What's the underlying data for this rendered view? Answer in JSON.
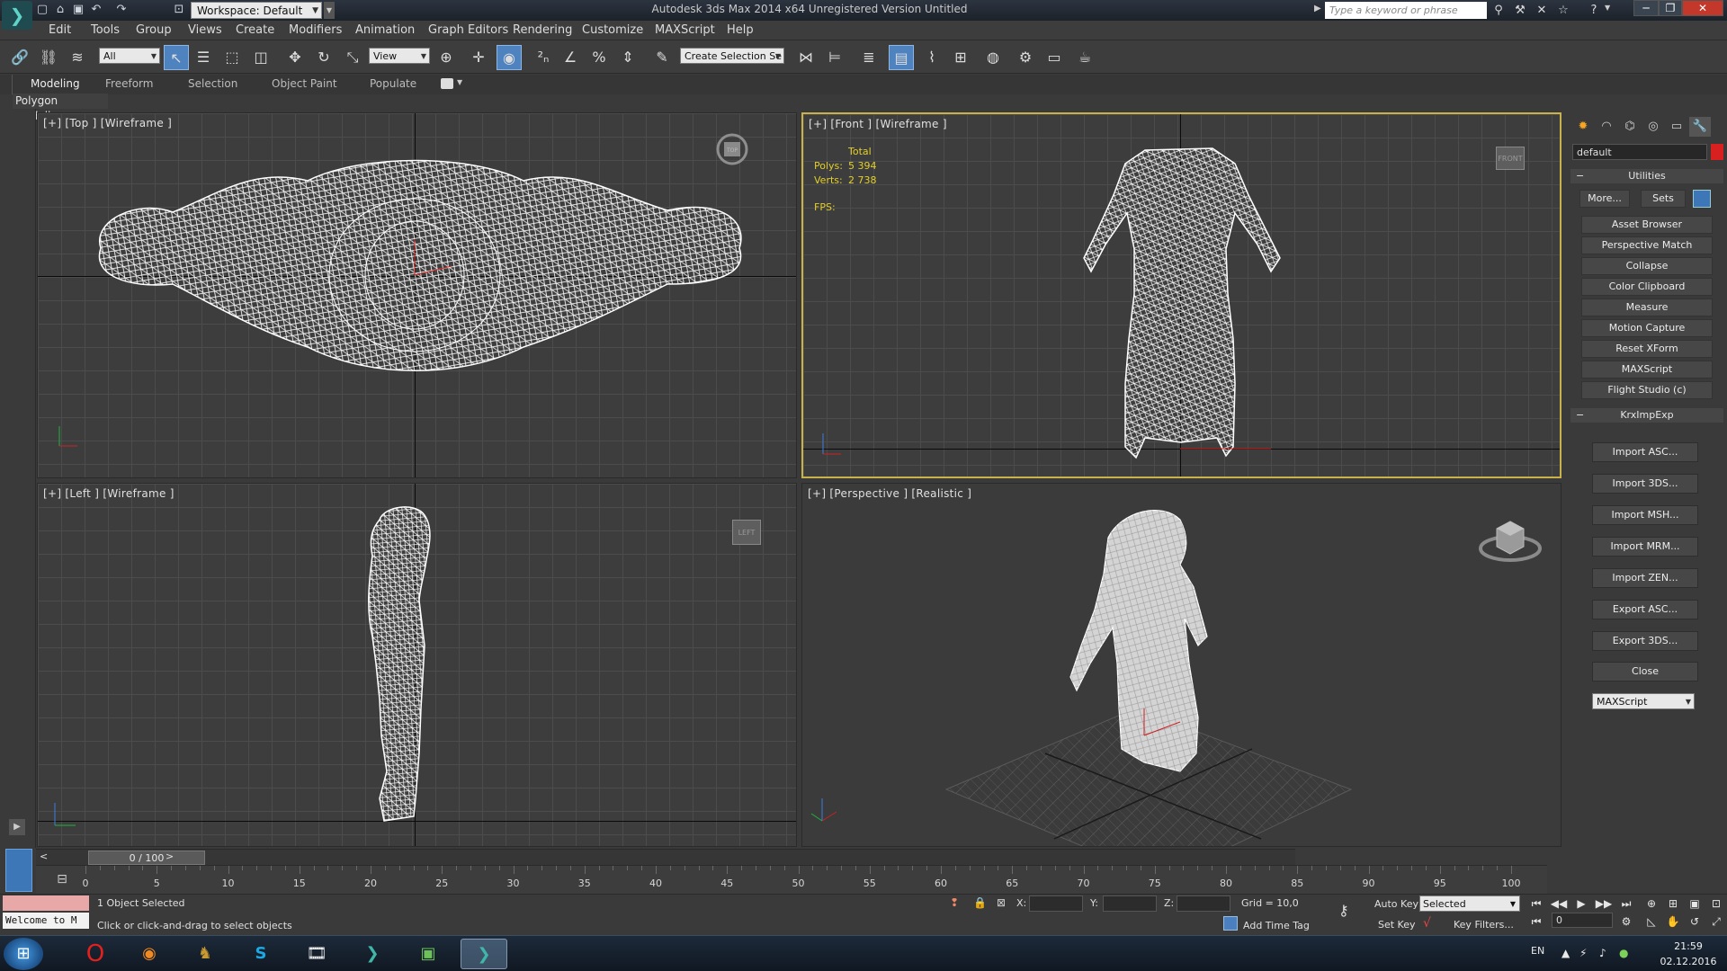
{
  "titlebar": {
    "app_title": "Autodesk 3ds Max 2014 x64    Unregistered Version    Untitled",
    "workspace": "Workspace: Default",
    "search_placeholder": "Type a keyword or phrase",
    "logo_glyph": "❯"
  },
  "menu": [
    "Edit",
    "Tools",
    "Group",
    "Views",
    "Create",
    "Modifiers",
    "Animation",
    "Graph Editors",
    "Rendering",
    "Customize",
    "MAXScript",
    "Help"
  ],
  "toolbar": {
    "selection_filter": "All",
    "ref_coord": "View",
    "named_selection": "Create Selection Se"
  },
  "ribbon": {
    "tabs": [
      "Modeling",
      "Freeform",
      "Selection",
      "Object Paint",
      "Populate"
    ],
    "active": "Modeling",
    "panel_label": "Polygon Modeling"
  },
  "viewports": {
    "top": {
      "label": "[+] [Top ] [Wireframe ]",
      "cube": "TOP"
    },
    "front": {
      "label": "[+] [Front ] [Wireframe ]",
      "cube": "FRONT"
    },
    "left": {
      "label": "[+] [Left ] [Wireframe ]",
      "cube": "LEFT"
    },
    "perspective": {
      "label": "[+] [Perspective ] [Realistic ]"
    }
  },
  "stats": {
    "header": "Total",
    "polys_label": "Polys:",
    "polys_value": "5 394",
    "verts_label": "Verts:",
    "verts_value": "2 738",
    "fps_label": "FPS:"
  },
  "command_panel": {
    "object_name": "default",
    "object_color": "#d92020",
    "utilities_title": "Utilities",
    "more_label": "More...",
    "sets_label": "Sets",
    "utilities": [
      "Asset Browser",
      "Perspective Match",
      "Collapse",
      "Color Clipboard",
      "Measure",
      "Motion Capture",
      "Reset XForm",
      "MAXScript",
      "Flight Studio (c)"
    ],
    "krx_title": "KrxImpExp",
    "krx_buttons": [
      "Import ASC...",
      "Import 3DS...",
      "Import MSH...",
      "Import MRM...",
      "Import ZEN...",
      "Export ASC...",
      "Export 3DS...",
      "Close"
    ],
    "krx_dropdown": "MAXScript"
  },
  "timeline": {
    "frame_display": "0 / 100",
    "prev": "<",
    "next": ">",
    "ticks": [
      "0",
      "5",
      "10",
      "15",
      "20",
      "25",
      "30",
      "35",
      "40",
      "45",
      "50",
      "55",
      "60",
      "65",
      "70",
      "75",
      "80",
      "85",
      "90",
      "95",
      "100"
    ]
  },
  "status": {
    "welcome": "Welcome to M",
    "selected": "1 Object Selected",
    "prompt": "Click or click-and-drag to select objects",
    "x_label": "X:",
    "y_label": "Y:",
    "z_label": "Z:",
    "grid": "Grid = 10,0",
    "add_time_tag": "Add Time Tag",
    "auto_key": "Auto Key",
    "set_key": "Set Key",
    "key_mode": "Selected",
    "key_filters": "Key Filters...",
    "frame": "0"
  },
  "taskbar": {
    "language": "EN",
    "time": "21:59",
    "date": "02.12.2016"
  }
}
